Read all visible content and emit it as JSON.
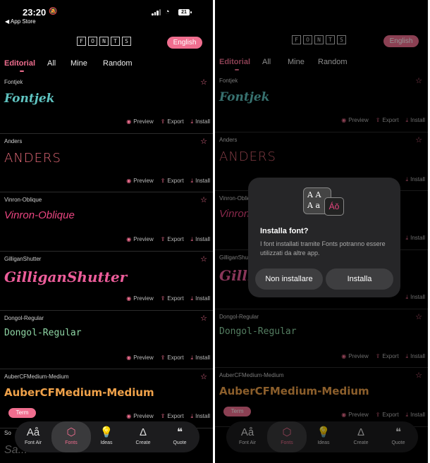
{
  "status": {
    "time": "23:20",
    "back": "◀ App Store",
    "battery": "21"
  },
  "header": {
    "logo_letters": [
      "F",
      "O",
      "N",
      "T",
      "S"
    ],
    "language": "English"
  },
  "tabs": [
    "Editorial",
    "All",
    "Mine",
    "Random"
  ],
  "fonts": [
    {
      "name": "Fontjek",
      "sample": "Fontjek"
    },
    {
      "name": "Anders",
      "sample": "ANDERS"
    },
    {
      "name": "Vinron-Oblique",
      "sample": "Vinron-Oblique"
    },
    {
      "name": "GilliganShutter",
      "sample": "GilliganShutter"
    },
    {
      "name": "Dongol-Regular",
      "sample": "Dongol-Regular"
    },
    {
      "name": "AuberCFMedium-Medium",
      "sample": "AuberCFMedium-Medium",
      "tag": "Term"
    }
  ],
  "actions": {
    "preview": "Preview",
    "export": "Export",
    "install": "Install"
  },
  "nav": [
    {
      "label": "Font Air",
      "icon": "Aå"
    },
    {
      "label": "Fonts",
      "icon": "⬡"
    },
    {
      "label": "Ideas",
      "icon": "💡"
    },
    {
      "label": "Create",
      "icon": "Δ"
    },
    {
      "label": "Quote",
      "icon": "❝"
    }
  ],
  "partial_next": "So",
  "ghost": "Sa...",
  "dialog": {
    "title": "Installa font?",
    "body": "I font installati tramite Fonts potranno essere utilizzati da altre app.",
    "cancel": "Non installare",
    "confirm": "Installa",
    "icon_letters": "A A\nA a",
    "icon_badge": "Áǒ"
  },
  "colors": {
    "accent": "#f06e8f",
    "background": "#000000"
  }
}
